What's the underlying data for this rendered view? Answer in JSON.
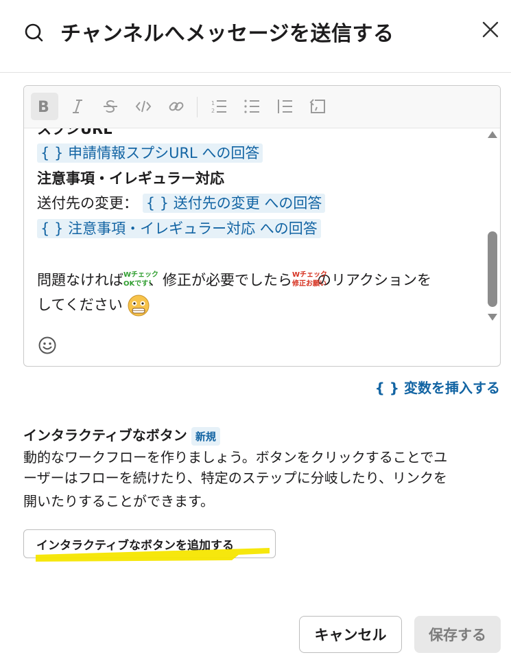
{
  "header": {
    "title": "チャンネルへメッセージを送信する",
    "icon": "search-icon",
    "close_icon": "close-icon"
  },
  "toolbar": {
    "buttons": [
      {
        "name": "bold-icon",
        "active": true
      },
      {
        "name": "italic-icon"
      },
      {
        "name": "strikethrough-icon"
      },
      {
        "name": "code-icon"
      },
      {
        "name": "link-icon"
      },
      {
        "name": "ordered-list-icon"
      },
      {
        "name": "bullet-list-icon"
      },
      {
        "name": "blockquote-icon"
      },
      {
        "name": "code-block-icon"
      }
    ]
  },
  "editor": {
    "line0": "スプシURL",
    "line1_var": "{ } 申請情報スプシURL への回答",
    "line2": "注意事項・イレギュラー対応",
    "line3_prefix": "送付先の変更：",
    "line3_var": "{ } 送付先の変更 への回答",
    "line4_var": "{ } 注意事項・イレギュラー対応 への回答",
    "line5_a": "問題なければ",
    "emoji1_top": "Wチェック",
    "emoji1_bottom": "OKです！",
    "line5_b": "、修正が必要でしたら",
    "emoji2_top": "Wチェック",
    "emoji2_bottom": "修正お願い",
    "line5_c": "のリアクションを",
    "line6": "してください",
    "face_emoji": "pleading-face-icon",
    "emoji_picker_icon": "smiley-icon"
  },
  "insert_variable": "{ } 変数を挿入する",
  "interactive": {
    "title": "インタラクティブなボタン",
    "badge": "新規",
    "desc1": "動的なワークフローを作りましょう。ボタンをクリックすることでユ",
    "desc2": "ーザーはフローを続けたり、特定のステップに分岐したり、リンクを",
    "desc3": "開いたりすることができます。",
    "add_button": "インタラクティブなボタンを追加する",
    "highlight_color": "#f5e600"
  },
  "footer": {
    "cancel": "キャンセル",
    "save": "保存する"
  },
  "colors": {
    "accent": "#1264a3",
    "variable_bg": "#e6f1f8",
    "disabled_text": "#7c7c7c"
  }
}
